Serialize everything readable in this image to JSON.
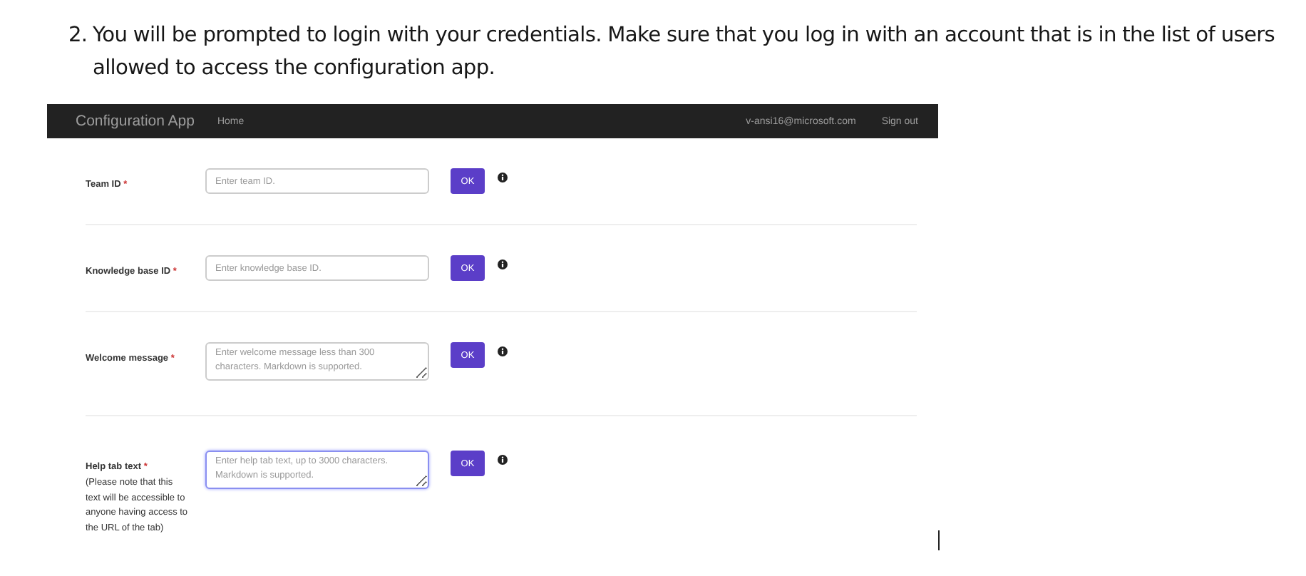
{
  "step": {
    "number": "2.",
    "text": "You will be prompted to login with your credentials. Make sure that you log in with an account that is in the list of users allowed to access the configuration app."
  },
  "navbar": {
    "brand": "Configuration App",
    "links": [
      "Home"
    ],
    "user": "v-ansi16@microsoft.com",
    "sign_out": "Sign out"
  },
  "fields": [
    {
      "label": "Team ID",
      "required_mark": "*",
      "kind": "input",
      "placeholder": "Enter team ID.",
      "focused": false,
      "button": "OK"
    },
    {
      "label": "Knowledge base ID",
      "required_mark": "*",
      "kind": "input",
      "placeholder": "Enter knowledge base ID.",
      "focused": false,
      "button": "OK"
    },
    {
      "label": "Welcome message",
      "required_mark": "*",
      "kind": "textarea",
      "placeholder": "Enter welcome message less than 300 characters. Markdown is supported.",
      "focused": false,
      "button": "OK"
    },
    {
      "label": "Help tab text",
      "required_mark": "*",
      "note": "(Please note that this text will be accessible to anyone having access to the URL of the tab)",
      "kind": "textarea",
      "placeholder": "Enter help tab text, up to 3000 characters. Markdown is supported.",
      "focused": true,
      "button": "OK"
    }
  ]
}
